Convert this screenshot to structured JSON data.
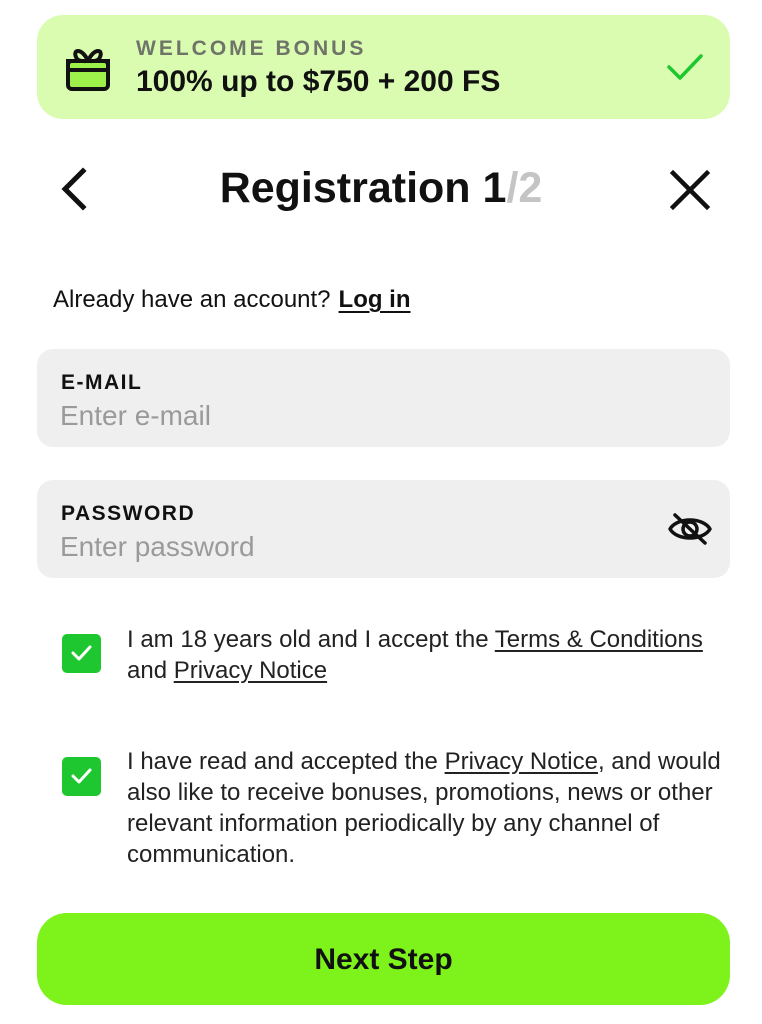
{
  "bonus": {
    "eyebrow": "WELCOME BONUS",
    "headline": "100% up to $750 + 200 FS",
    "icon": "gift-icon",
    "status_icon": "checkmark-icon",
    "background_color": "#dafcb0",
    "accent_color": "#1ec72f"
  },
  "header": {
    "back_icon": "chevron-left-icon",
    "title": "Registration",
    "step_current": "1",
    "step_separator": "/",
    "step_total": "2",
    "close_icon": "close-icon"
  },
  "login_prompt": {
    "text": "Already have an account?",
    "link_label": "Log in"
  },
  "form": {
    "email": {
      "label": "E-MAIL",
      "placeholder": "Enter e-mail",
      "value": ""
    },
    "password": {
      "label": "PASSWORD",
      "placeholder": "Enter password",
      "value": "",
      "toggle_icon": "eye-slash-icon"
    }
  },
  "consents": [
    {
      "checked": true,
      "text_before": "I am 18 years old and I accept the ",
      "link1": "Terms & Conditions",
      "text_middle": " and ",
      "link2": "Privacy Notice",
      "text_after": ""
    },
    {
      "checked": true,
      "text_before": "I have read and accepted the ",
      "link1": "Privacy Notice",
      "text_after": ", and would also like to receive bonuses, promotions, news or other relevant information periodically by any channel of communication."
    }
  ],
  "next_button": {
    "label": "Next Step",
    "color": "#7df21b"
  },
  "colors": {
    "checkbox_green": "#1ec72f",
    "field_background": "#efefef",
    "muted_step": "#c4c4c4"
  }
}
